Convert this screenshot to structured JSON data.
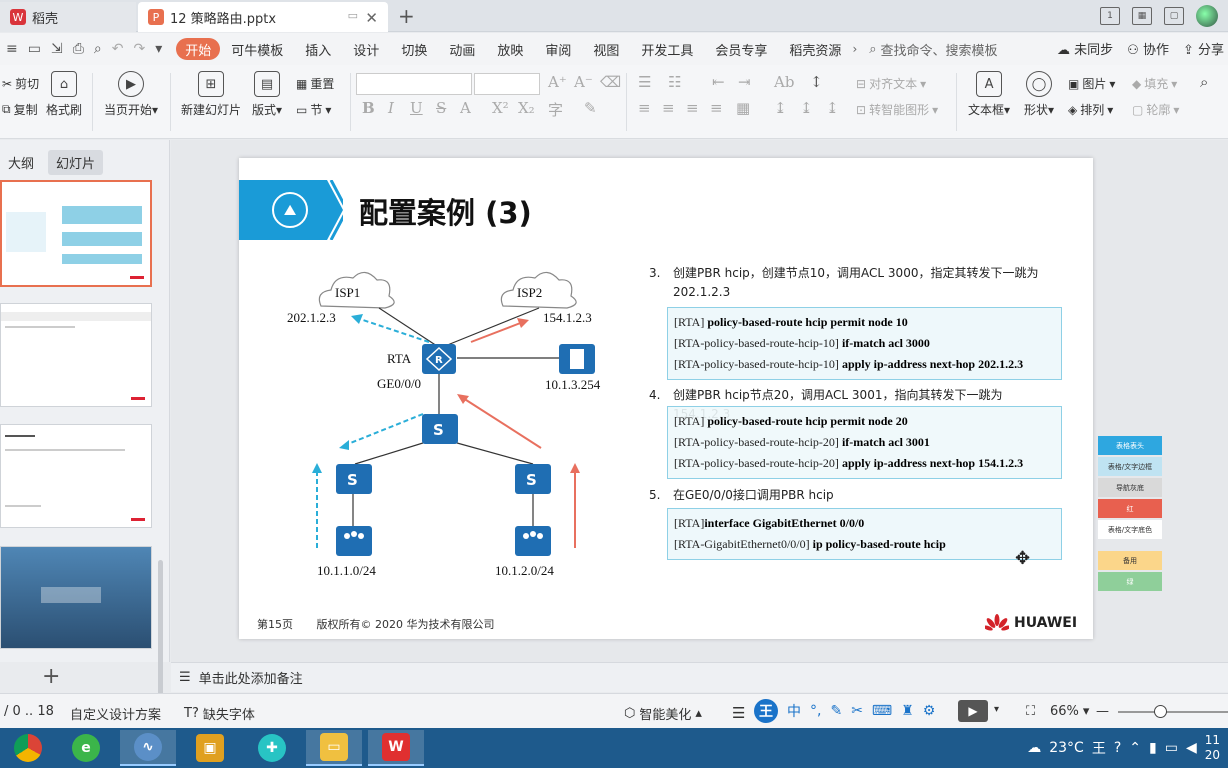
{
  "tabs": [
    {
      "label": "稻壳",
      "logo": "W"
    },
    {
      "label": "12 策略路由.pptx",
      "logo": "P"
    }
  ],
  "menu": {
    "items": [
      "开始",
      "插入",
      "设计",
      "切换",
      "动画",
      "放映",
      "审阅",
      "视图",
      "开发工具",
      "会员专享",
      "稻壳资源"
    ],
    "template": "可牛模板",
    "search": "查找命令、搜索模板",
    "right": [
      "未同步",
      "协作",
      "分享"
    ]
  },
  "ribbon": {
    "cut": "剪切",
    "copy": "复制",
    "format_painter": "格式刷",
    "start_current": "当页开始",
    "new_slide": "新建幻灯片",
    "layout": "版式",
    "reset": "重置",
    "section": "节",
    "align_text": "对齐文本",
    "smartart": "转智能图形",
    "textbox": "文本框",
    "shape": "形状",
    "picture": "图片",
    "arrange": "排列",
    "fill": "填充",
    "outline": "轮廓"
  },
  "left_panel": {
    "tab_outline": "大纲",
    "tab_slides": "幻灯片",
    "add": "+"
  },
  "slide": {
    "title": "配置案例 (3)",
    "topology": {
      "isp1": "ISP1",
      "isp2": "ISP2",
      "ip_isp1": "202.1.2.3",
      "ip_isp2": "154.1.2.3",
      "rta": "RTA",
      "ge": "GE0/0/0",
      "server_ip": "10.1.3.254",
      "net1": "10.1.1.0/24",
      "net2": "10.1.2.0/24"
    },
    "steps": [
      {
        "num": "3.",
        "text": "创建PBR hcip，创建节点10，调用ACL 3000，指定其转发下一跳为202.1.2.3",
        "code": [
          {
            "prefix": "[RTA] ",
            "cmd": "policy-based-route hcip permit node 10"
          },
          {
            "prefix": "[RTA-policy-based-route-hcip-10] ",
            "cmd": "if-match acl 3000"
          },
          {
            "prefix": "[RTA-policy-based-route-hcip-10] ",
            "cmd": "apply ip-address next-hop 202.1.2.3"
          }
        ]
      },
      {
        "num": "4.",
        "text": "创建PBR hcip节点20，调用ACL 3001，指向其转发下一跳为154.1.2.3",
        "code": [
          {
            "prefix": "[RTA] ",
            "cmd": "policy-based-route hcip permit node 20"
          },
          {
            "prefix": "[RTA-policy-based-route-hcip-20] ",
            "cmd": "if-match acl 3001"
          },
          {
            "prefix": "[RTA-policy-based-route-hcip-20] ",
            "cmd": "apply ip-address next-hop 154.1.2.3"
          }
        ]
      },
      {
        "num": "5.",
        "text": "在GE0/0/0接口调用PBR hcip",
        "code": [
          {
            "prefix": "[RTA]",
            "cmd": "interface GigabitEthernet 0/0/0"
          },
          {
            "prefix": "[RTA-GigabitEthernet0/0/0] ",
            "cmd": "ip policy-based-route hcip"
          }
        ]
      }
    ],
    "footer_page": "第15页",
    "footer_copyright": "版权所有© 2020 华为技术有限公司",
    "brand": "HUAWEI"
  },
  "palette": [
    {
      "label": "表格表头",
      "color": "#2ea7e0"
    },
    {
      "label": "表格/文字边框",
      "color": "#bfe3f2"
    },
    {
      "label": "导航灰底",
      "color": "#d9d9d9"
    },
    {
      "label": "红",
      "color": "#e8604f"
    },
    {
      "label": "表格/文字底色",
      "color": "#ffffff"
    },
    {
      "label": "备用",
      "color": "#fbd68a"
    },
    {
      "label": "绿",
      "color": "#8fcf9a"
    }
  ],
  "notes_placeholder": "单击此处添加备注",
  "status": {
    "page": "/ 0 .. 18",
    "design": "自定义设计方案",
    "missing_font": "缺失字体",
    "beautify": "智能美化",
    "zoom": "66%"
  },
  "taskbar": {
    "weather": "23°C",
    "time": "11",
    "date": "20"
  }
}
